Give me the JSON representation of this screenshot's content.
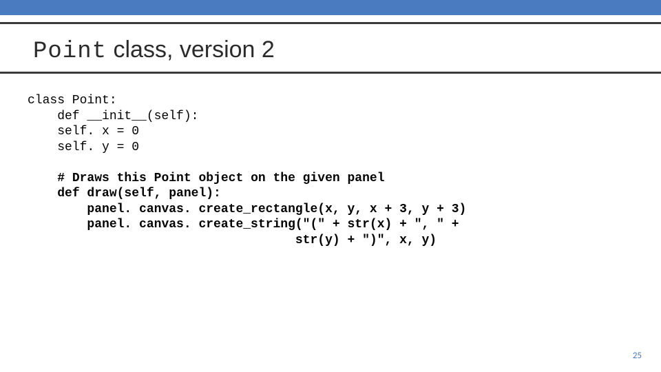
{
  "heading": {
    "mono": "Point",
    "rest": " class, version 2"
  },
  "code": {
    "l1": "class Point:",
    "l2": "    def __init__(self):",
    "l3": "    self. x = 0",
    "l4": "    self. y = 0",
    "l5": "",
    "l6a": "    ",
    "l6b": "# Draws this Point object on the given panel",
    "l7a": "    ",
    "l7b": "def draw(self, panel):",
    "l8a": "        ",
    "l8b": "panel. canvas. create_rectangle(x, y, x + 3, y + 3)",
    "l9a": "        ",
    "l9b": "panel. canvas. create_string(\"(\" + str(x) + \", \" +",
    "l10a": "                                    ",
    "l10b": "str(y) + \")\", x, y)"
  },
  "page_number": "25"
}
